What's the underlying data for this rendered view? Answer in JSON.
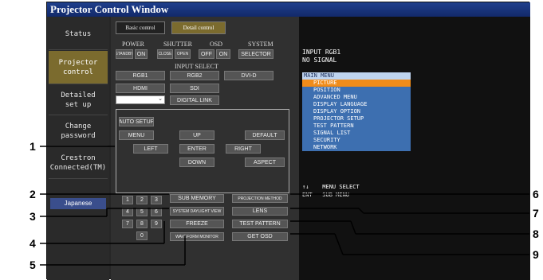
{
  "title": "Projector Control Window",
  "sidebar": {
    "items": [
      {
        "label": "Status"
      },
      {
        "label": "Projector\ncontrol"
      },
      {
        "label": "Detailed\nset up"
      },
      {
        "label": "Change\npassword"
      },
      {
        "label": "Crestron\nConnected(TM)"
      }
    ],
    "language": "Japanese"
  },
  "tabs": {
    "basic": "Basic control",
    "detail": "Detail control"
  },
  "headers": {
    "power": "POWER",
    "shutter": "SHUTTER",
    "osd": "OSD",
    "system": "SYSTEM",
    "input_select": "INPUT SELECT"
  },
  "buttons": {
    "standby": "STANDBY",
    "on": "ON",
    "close": "CLOSE",
    "open": "OPEN",
    "osd_off": "OFF",
    "osd_on": "ON",
    "selector": "SELECTOR",
    "rgb1": "RGB1",
    "rgb2": "RGB2",
    "dvid": "DVI-D",
    "hdmi": "HDMI",
    "sdi": "SDI",
    "digital_link": "DIGITAL LINK",
    "auto_setup": "AUTO SETUP",
    "menu": "MENU",
    "up": "UP",
    "default": "DEFAULT",
    "left": "LEFT",
    "enter": "ENTER",
    "right": "RIGHT",
    "down": "DOWN",
    "aspect": "ASPECT",
    "sub_memory": "SUB MEMORY",
    "projection_method": "PROJECTION METHOD",
    "system_daylight_view": "SYSTEM DAYLIGHT VIEW",
    "lens": "LENS",
    "freeze": "FREEZE",
    "test_pattern": "TEST PATTERN",
    "waveform_monitor": "WAVEFORM MONITOR",
    "get_osd": "GET OSD"
  },
  "keypad": [
    "1",
    "2",
    "3",
    "4",
    "5",
    "6",
    "7",
    "8",
    "9",
    "0"
  ],
  "osd_screen": {
    "line1": "INPUT RGB1",
    "line2": "NO SIGNAL",
    "menu_title": "MAIN MENU",
    "menu_items": [
      "PICTURE",
      "POSITION",
      "ADVANCED MENU",
      "DISPLAY LANGUAGE",
      "DISPLAY OPTION",
      "PROJECTOR SETUP",
      "TEST PATTERN",
      "SIGNAL LIST",
      "SECURITY",
      "NETWORK"
    ],
    "footer1": "↑↓    MENU SELECT",
    "footer2": "ENT   SUB MENU"
  },
  "callouts": [
    "1",
    "2",
    "3",
    "4",
    "5",
    "6",
    "7",
    "8",
    "9"
  ]
}
